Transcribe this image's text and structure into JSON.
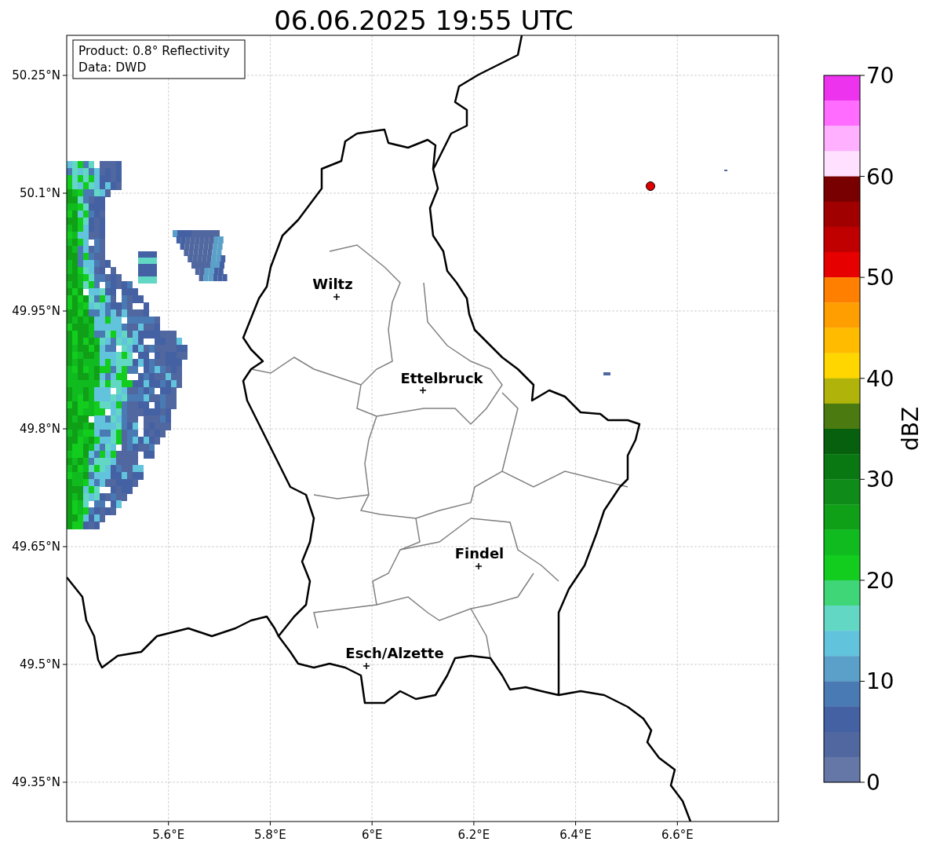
{
  "title": "06.06.2025 19:55 UTC",
  "info_box": [
    "Product: 0.8° Reflectivity",
    "Data: DWD"
  ],
  "x_axis": {
    "ticks": [
      "5.6°E",
      "5.8°E",
      "6°E",
      "6.2°E",
      "6.4°E",
      "6.6°E"
    ]
  },
  "y_axis": {
    "ticks": [
      "50.25°N",
      "50.1°N",
      "49.95°N",
      "49.8°N",
      "49.65°N",
      "49.5°N",
      "49.35°N"
    ]
  },
  "cities": [
    {
      "name": "Wiltz"
    },
    {
      "name": "Ettelbruck"
    },
    {
      "name": "Findel"
    },
    {
      "name": "Esch/Alzette"
    }
  ],
  "colorbar": {
    "label": "dBZ",
    "ticks": [
      "70",
      "60",
      "50",
      "40",
      "30",
      "20",
      "10",
      "0"
    ],
    "levels": [
      {
        "color": "#ee33ee"
      },
      {
        "color": "#ff6cff"
      },
      {
        "color": "#ffb0ff"
      },
      {
        "color": "#ffe0ff"
      },
      {
        "color": "#780000"
      },
      {
        "color": "#a00000"
      },
      {
        "color": "#c00000"
      },
      {
        "color": "#e60000"
      },
      {
        "color": "#ff8000"
      },
      {
        "color": "#ff9e00"
      },
      {
        "color": "#ffbb00"
      },
      {
        "color": "#ffd600"
      },
      {
        "color": "#b0b40a"
      },
      {
        "color": "#4a7a10"
      },
      {
        "color": "#07600d"
      },
      {
        "color": "#0a7812"
      },
      {
        "color": "#0e8b18"
      },
      {
        "color": "#0fa018"
      },
      {
        "color": "#10bb20"
      },
      {
        "color": "#12cc1e"
      },
      {
        "color": "#3ed676"
      },
      {
        "color": "#62d8c4"
      },
      {
        "color": "#62c3dc"
      },
      {
        "color": "#5aa0c8"
      },
      {
        "color": "#4a7ab4"
      },
      {
        "color": "#4461a3"
      },
      {
        "color": "#5067a0"
      },
      {
        "color": "#6577a6"
      }
    ]
  }
}
